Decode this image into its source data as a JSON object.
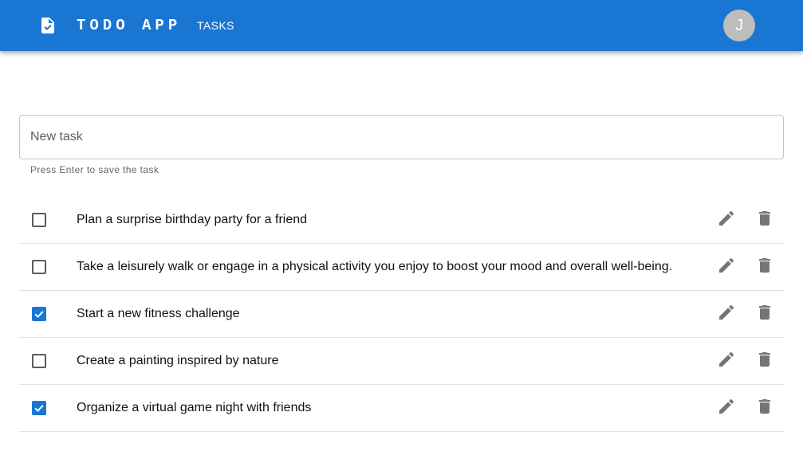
{
  "header": {
    "app_title": "TODO APP",
    "nav_tasks": "TASKS",
    "avatar_initial": "J",
    "brand_color": "#1976d2"
  },
  "new_task": {
    "placeholder": "New task",
    "value": "",
    "helper": "Press Enter to save the task"
  },
  "tasks": [
    {
      "text": "Plan a surprise birthday party for a friend",
      "completed": false
    },
    {
      "text": "Take a leisurely walk or engage in a physical activity you enjoy to boost your mood and overall well-being.",
      "completed": false
    },
    {
      "text": "Start a new fitness challenge",
      "completed": true
    },
    {
      "text": "Create a painting inspired by nature",
      "completed": false
    },
    {
      "text": "Organize a virtual game night with friends",
      "completed": true
    }
  ],
  "icons": {
    "logo": "task-document-icon",
    "edit": "pencil-icon",
    "delete": "trash-icon",
    "check": "check-icon"
  }
}
